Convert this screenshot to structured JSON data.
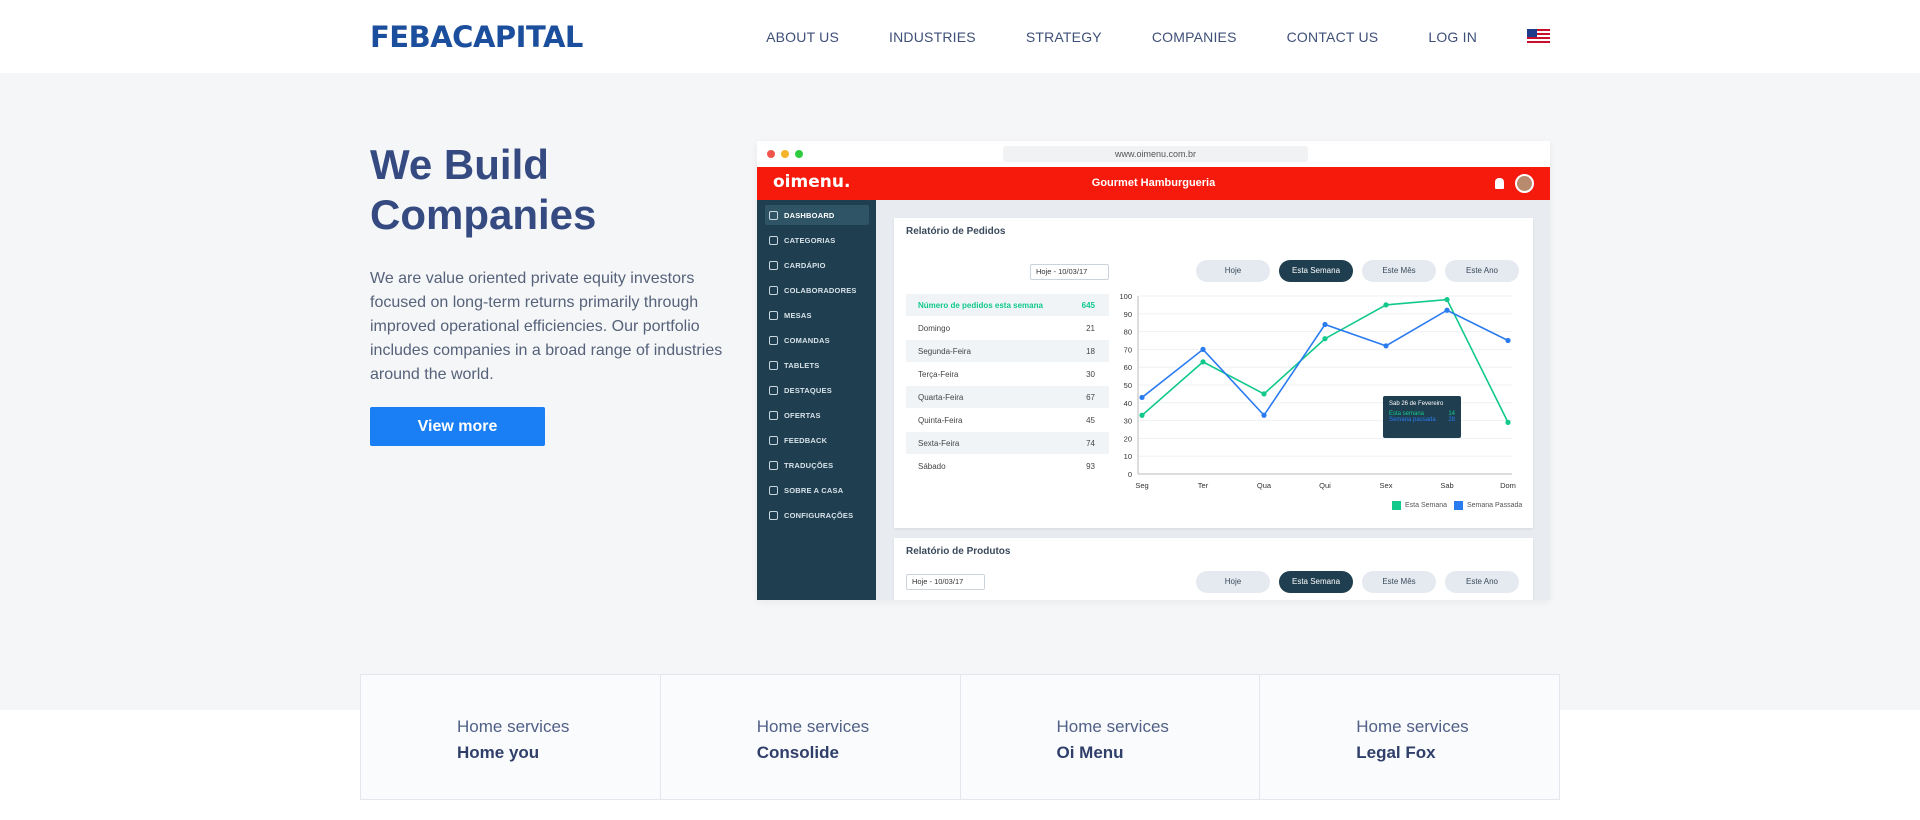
{
  "header": {
    "logo": "FEBACAPITAL",
    "nav": [
      "ABOUT US",
      "INDUSTRIES",
      "STRATEGY",
      "COMPANIES",
      "CONTACT US",
      "LOG IN"
    ],
    "flag_icon": "us-flag-icon"
  },
  "hero": {
    "title": "We Build Companies",
    "text": "We are value oriented private equity investors focused on long-term returns primarily through improved operational efficiencies. Our portfolio includes companies in a broad range of industries around the world.",
    "button": "View more"
  },
  "mockup": {
    "url": "www.oimenu.com.br",
    "brand": "oimenu.",
    "title": "Gourmet Hamburgueria",
    "sidebar": [
      "DASHBOARD",
      "CATEGORIAS",
      "CARDÁPIO",
      "COLABORADORES",
      "MESAS",
      "COMANDAS",
      "TABLETS",
      "DESTAQUES",
      "OFERTAS",
      "FEEDBACK",
      "TRADUÇÕES",
      "SOBRE A CASA",
      "CONFIGURAÇÕES"
    ],
    "card1": {
      "title": "Relatório de Pedidos",
      "select": "Hoje - 10/03/17",
      "pills": [
        "Hoje",
        "Esta Semana",
        "Este Mês",
        "Este Ano"
      ],
      "table": [
        {
          "label": "Número de pedidos esta semana",
          "value": "645"
        },
        {
          "label": "Domingo",
          "value": "21"
        },
        {
          "label": "Segunda-Feira",
          "value": "18"
        },
        {
          "label": "Terça-Feira",
          "value": "30"
        },
        {
          "label": "Quarta-Feira",
          "value": "67"
        },
        {
          "label": "Quinta-Feira",
          "value": "45"
        },
        {
          "label": "Sexta-Feira",
          "value": "74"
        },
        {
          "label": "Sábado",
          "value": "93"
        }
      ],
      "tooltip": {
        "title": "Sab 26 de Fevereiro",
        "line1": "Esta semana",
        "v1": "14",
        "line2": "Semana passada",
        "v2": "28"
      }
    },
    "card2": {
      "title": "Relatório de Produtos",
      "select": "Hoje - 10/03/17",
      "pills": [
        "Hoje",
        "Esta Semana",
        "Este Mês",
        "Este Ano"
      ]
    }
  },
  "chart_data": {
    "type": "line",
    "categories": [
      "Seg",
      "Ter",
      "Qua",
      "Qui",
      "Sex",
      "Sab",
      "Dom"
    ],
    "ylim": [
      0,
      100
    ],
    "yticks": [
      0,
      10,
      20,
      30,
      40,
      50,
      60,
      70,
      80,
      90,
      100
    ],
    "series": [
      {
        "name": "Esta Semana",
        "color": "#10c98a",
        "values": [
          33,
          63,
          45,
          76,
          95,
          98,
          29
        ]
      },
      {
        "name": "Semana Passada",
        "color": "#2a7bf0",
        "values": [
          43,
          70,
          33,
          84,
          72,
          92,
          75
        ]
      }
    ]
  },
  "features": [
    {
      "sub": "Home services",
      "name": "Home you"
    },
    {
      "sub": "Home services",
      "name": "Consolide"
    },
    {
      "sub": "Home services",
      "name": "Oi Menu"
    },
    {
      "sub": "Home services",
      "name": "Legal Fox"
    }
  ]
}
